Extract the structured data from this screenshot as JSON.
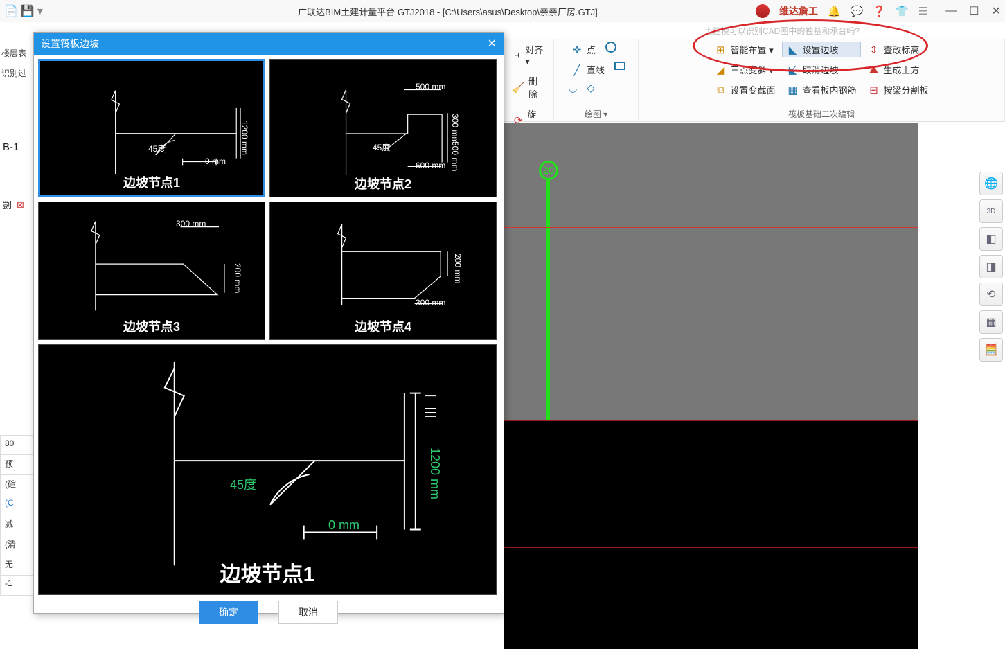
{
  "app_title": "广联达BIM土建计量平台 GTJ2018 - [C:\\Users\\asus\\Desktop\\亲亲厂房.GTJ]",
  "brand": "维达詹工",
  "search_hint": "土建模可以识别CAD图中的独基和承台吗?",
  "ribbon": {
    "align": "对齐 ▾",
    "delete": "删除",
    "rotate": "旋转",
    "point": "点",
    "line": "直线",
    "draw_group": "绘图 ▾",
    "smart": "智能布置 ▾",
    "threept": "三点变斜 ▾",
    "setsection": "设置变截面",
    "setslope": "设置边坡",
    "cancelslope": "取消边坡",
    "viewrebar": "查看板内钢筋",
    "modelev": "查改标高",
    "gensoil": "生成土方",
    "splitbeam": "按梁分割板",
    "group2": "筏板基础二次编辑"
  },
  "left": {
    "l1": "楼层表",
    "l2": "识别过",
    "b1": "B-1",
    "copy": "剴",
    "rows": [
      "80",
      "预",
      "(碹",
      "(C",
      "减",
      "(清",
      "无",
      "-1"
    ]
  },
  "dialog": {
    "title": "设置筏板边坡",
    "thumbs": [
      {
        "label": "边坡节点1",
        "dims": {
          "h": "1200",
          "w": "0",
          "ang": "45度"
        }
      },
      {
        "label": "边坡节点2",
        "dims": {
          "t": "500",
          "r": "300",
          "b": "600",
          "rb": "500",
          "ang": "45度"
        }
      },
      {
        "label": "边坡节点3",
        "dims": {
          "t": "300 mm",
          "r": "200 mm"
        }
      },
      {
        "label": "边坡节点4",
        "dims": {
          "b": "300 mm",
          "r": "200 mm"
        }
      }
    ],
    "big": {
      "label": "边坡节点1",
      "h": "1200 mm",
      "w": "0 mm",
      "ang": "45度"
    },
    "ok": "确定",
    "cancel": "取消"
  },
  "canvas": {
    "axis_label": "20"
  }
}
